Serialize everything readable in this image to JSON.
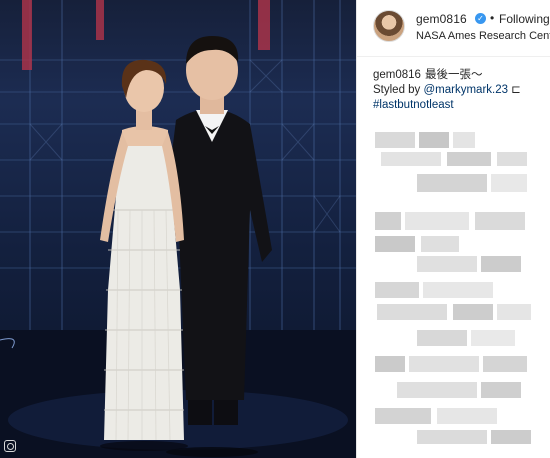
{
  "post": {
    "username": "gem0816",
    "follow_status": "Following",
    "separator": "•",
    "location": "NASA Ames Research Center",
    "verified_icon": "verified-badge-icon",
    "caption": {
      "username": "gem0816",
      "text": "最後一張～",
      "styled_prefix": "Styled by ",
      "styled_mention": "@markymark.23",
      "styled_suffix": " ⊏",
      "hashtag": "#lastbutnotleast"
    },
    "colors": {
      "link": "#003569",
      "verified": "#3897f0",
      "text": "#262626"
    }
  },
  "photo": {
    "icon": "instagram-corner-icon"
  }
}
